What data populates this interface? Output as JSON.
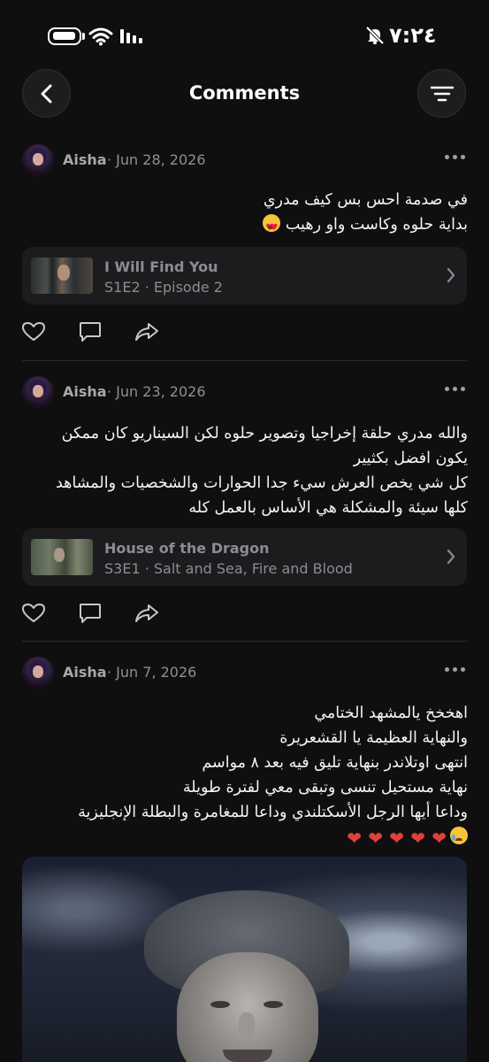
{
  "status_bar": {
    "time": "٧:٢٤"
  },
  "header": {
    "title": "Comments"
  },
  "comments": [
    {
      "author": "Aisha",
      "date": "· Jun 28, 2026",
      "lines": [
        "في صدمة احس بس كيف مدري",
        "بداية حلوه وكاست واو رهيب"
      ],
      "emoji_last_line": [
        "smiling-face-with-heart-eyes"
      ],
      "episode": {
        "show": "I Will Find You",
        "subtitle": "S1E2 · Episode 2"
      }
    },
    {
      "author": "Aisha",
      "date": "· Jun 23, 2026",
      "lines": [
        "والله مدري حلقة إخراجيا وتصوير حلوه لكن السيناريو كان ممكن",
        "يكون افضل بكثيير",
        "كل شي يخص العرش سيء جدا الحوارات والشخصيات والمشاهد",
        "كلها سيئة والمشكلة هي الأساس بالعمل كله"
      ],
      "episode": {
        "show": "House of the Dragon",
        "subtitle": "S3E1 · Salt and Sea, Fire and Blood"
      }
    },
    {
      "author": "Aisha",
      "date": "· Jun 7, 2026",
      "lines": [
        "اهخخخ يالمشهد الختامي",
        "والنهاية العظيمة يا القشعريرة",
        "انتهى اوتلاندر بنهاية تليق فيه بعد ٨ مواسم",
        "نهاية مستحيل تنسى وتبقى معي لفترة طويلة",
        "وداعا أيها الرجل الأسكتلندي وداعا للمغامرة والبطلة الإنجليزية"
      ],
      "emoji_line": [
        "crying-face",
        "red-heart",
        "red-heart",
        "red-heart",
        "red-heart",
        "red-heart"
      ]
    }
  ]
}
